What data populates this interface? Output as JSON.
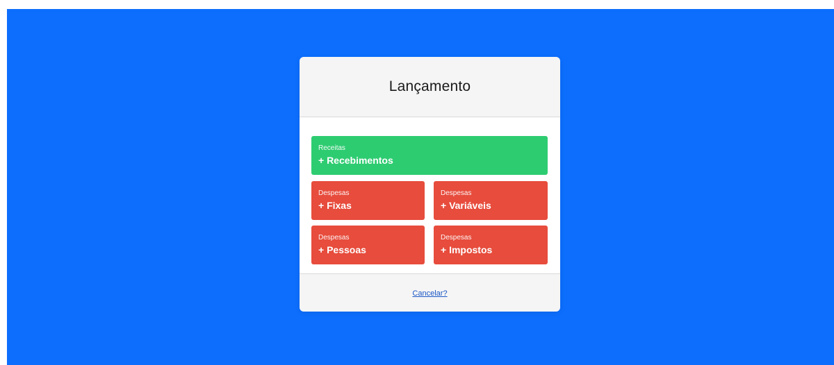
{
  "modal": {
    "title": "Lançamento",
    "cards": [
      {
        "sub": "Receitas",
        "main": "+ Recebimentos",
        "color": "#2ecc71"
      },
      {
        "sub": "Despesas",
        "main": "+ Fixas",
        "color": "#e74c3c"
      },
      {
        "sub": "Despesas",
        "main": "+ Variáveis",
        "color": "#e74c3c"
      },
      {
        "sub": "Despesas",
        "main": "+ Pessoas",
        "color": "#e74c3c"
      },
      {
        "sub": "Despesas",
        "main": "+ Impostos",
        "color": "#e74c3c"
      }
    ],
    "cancel_label": "Cancelar?"
  },
  "colors": {
    "backdrop": "#0d6efd",
    "modal_bg": "#f5f5f6",
    "link": "#1a56c4"
  }
}
